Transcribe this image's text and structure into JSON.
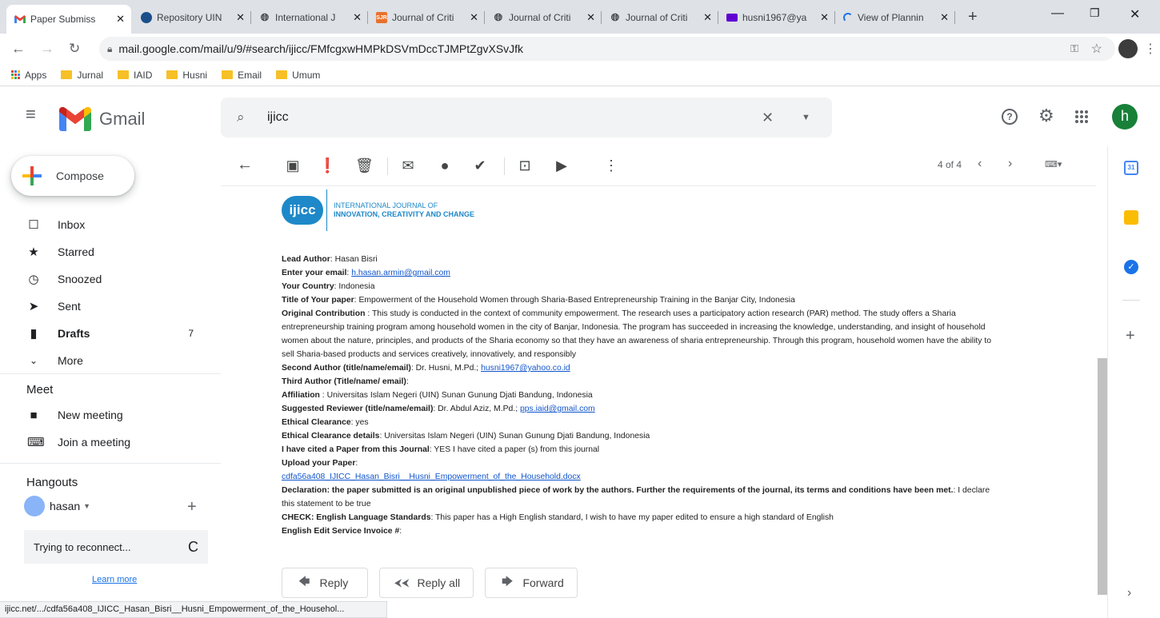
{
  "tabs": [
    {
      "title": "Paper Submiss",
      "favicon": "gmail-icon",
      "active": true
    },
    {
      "title": "Repository UIN",
      "favicon": "uin-icon"
    },
    {
      "title": "International J",
      "favicon": "globe-icon"
    },
    {
      "title": "Journal of Criti",
      "favicon": "sjr-icon",
      "favicon_text": "SJR"
    },
    {
      "title": "Journal of Criti",
      "favicon": "globe-icon"
    },
    {
      "title": "Journal of Criti",
      "favicon": "globe-icon"
    },
    {
      "title": "husni1967@ya",
      "favicon": "yahoo-mail-icon"
    },
    {
      "title": "View of Plannin",
      "favicon": "loading-icon"
    }
  ],
  "address": {
    "url": "mail.google.com/mail/u/9/#search/ijicc/FMfcgxwHMPkDSVmDccTJMPtZgvXSvJfk"
  },
  "bookmarks": [
    {
      "label": "Apps",
      "icon": "apps-grid-icon"
    },
    {
      "label": "Jurnal"
    },
    {
      "label": "IAID"
    },
    {
      "label": "Husni"
    },
    {
      "label": "Email"
    },
    {
      "label": "Umum"
    }
  ],
  "gmail": {
    "brand": "Gmail",
    "search_value": "ijicc",
    "avatar_letter": "h",
    "avatar_color": "#188038"
  },
  "sidebar": {
    "compose_label": "Compose",
    "items": [
      {
        "label": "Inbox",
        "icon": "inbox-icon",
        "count": ""
      },
      {
        "label": "Starred",
        "icon": "star-icon",
        "count": ""
      },
      {
        "label": "Snoozed",
        "icon": "clock-icon",
        "count": ""
      },
      {
        "label": "Sent",
        "icon": "send-icon",
        "count": ""
      },
      {
        "label": "Drafts",
        "icon": "draft-icon",
        "count": "7"
      },
      {
        "label": "More",
        "icon": "chevron-down-icon",
        "count": ""
      }
    ],
    "meet_title": "Meet",
    "meet_items": [
      {
        "label": "New meeting",
        "icon": "video-icon"
      },
      {
        "label": "Join a meeting",
        "icon": "keyboard-icon"
      }
    ],
    "hangouts_title": "Hangouts",
    "hangouts_user": "hasan",
    "reconnect_text": "Trying to reconnect...",
    "learn_more": "Learn more"
  },
  "message_toolbar": {
    "pagination": "4 of 4"
  },
  "email": {
    "logo_text": "ijicc",
    "logo_line1": "INTERNATIONAL JOURNAL OF",
    "logo_line2": "INNOVATION, CREATIVITY AND CHANGE",
    "fields": [
      {
        "label": "Lead Author",
        "sep": ": ",
        "value": "Hasan Bisri"
      },
      {
        "label": "Enter your email",
        "sep": ": ",
        "link": "h.hasan.armin@gmail.com"
      },
      {
        "label": "Your Country",
        "sep": ": ",
        "value": "Indonesia"
      },
      {
        "label": "Title of Your paper",
        "sep": ": ",
        "value": "Empowerment of the Household Women through Sharia-Based Entrepreneurship Training in the Banjar City, Indonesia"
      }
    ],
    "contribution_label": "Original Contribution",
    "contribution_lines": [
      " : This study is conducted in the context of community empowerment. The research uses a participatory action research (PAR) method. The study offers a Sharia",
      "entrepreneurship training program among household women in the city of Banjar, Indonesia. The program has succeeded in increasing the knowledge, understanding, and insight of household",
      "women about the nature, principles, and products of the Sharia economy so that they have an awareness of sharia entrepreneurship. Through this program, household women have the ability to",
      "sell Sharia-based products and services creatively, innovatively, and responsibly"
    ],
    "second_author_label": "Second Author (title/name/email)",
    "second_author_value": ": Dr. Husni, M.Pd.; ",
    "second_author_link": "husni1967@yahoo.co.id",
    "third_author_label": "Third Author (Title/name/ email)",
    "third_author_value": ":",
    "affiliation_label": "Affiliation",
    "affiliation_value": " : Universitas Islam Negeri (UIN) Sunan Gunung Djati Bandung, Indonesia",
    "reviewer_label": "Suggested Reviewer (title/name/email)",
    "reviewer_value": ": Dr. Abdul Aziz, M.Pd.; ",
    "reviewer_link": "pps.iaid@gmail.com",
    "ethical_label": "Ethical Clearance",
    "ethical_value": ": yes",
    "ethical_details_label": "Ethical Clearance details",
    "ethical_details_value": ": Universitas Islam Negeri (UIN) Sunan Gunung Djati Bandung, Indonesia",
    "cited_label": "I have cited a Paper from this Journal",
    "cited_value": ": YES I have cited a paper (s) from this journal",
    "upload_label": "Upload your Paper",
    "upload_value": ":",
    "upload_link": "cdfa56a408_IJICC_Hasan_Bisri__Husni_Empowerment_of_the_Household.docx",
    "declaration_label": "Declaration: the paper submitted is an original unpublished piece of work by the authors. Further the requirements of the journal, its terms and conditions have been met.",
    "declaration_value": ": I declare",
    "declaration_line2": "this statement to be true",
    "check_label": "CHECK: English Language Standards",
    "check_value": ": This paper has a High English standard, I wish to have my paper edited to ensure a high standard of English",
    "invoice_label": "English Edit Service Invoice #",
    "invoice_value": ":"
  },
  "actions": {
    "reply": "Reply",
    "reply_all": "Reply all",
    "forward": "Forward"
  },
  "status_bar": "ijicc.net/.../cdfa56a408_IJICC_Hasan_Bisri__Husni_Empowerment_of_the_Househol..."
}
